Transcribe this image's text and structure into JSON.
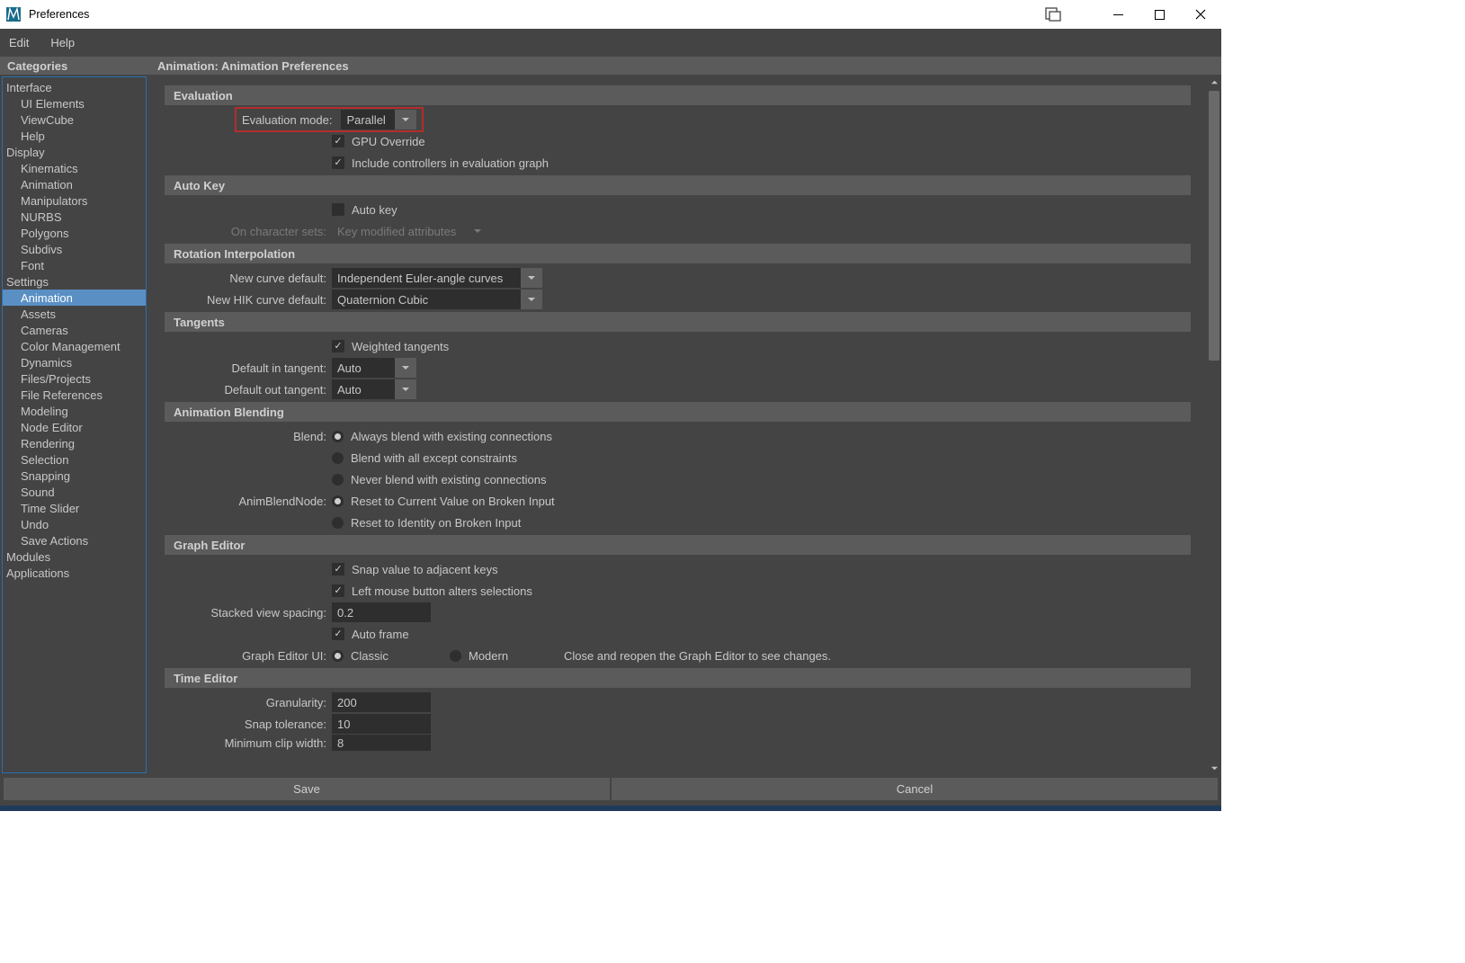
{
  "window": {
    "title": "Preferences"
  },
  "menubar": {
    "edit": "Edit",
    "help": "Help"
  },
  "categories": {
    "header": "Categories",
    "items": [
      {
        "label": "Interface",
        "indent": false
      },
      {
        "label": "UI Elements",
        "indent": true
      },
      {
        "label": "ViewCube",
        "indent": true
      },
      {
        "label": "Help",
        "indent": true
      },
      {
        "label": "Display",
        "indent": false
      },
      {
        "label": "Kinematics",
        "indent": true
      },
      {
        "label": "Animation",
        "indent": true
      },
      {
        "label": "Manipulators",
        "indent": true
      },
      {
        "label": "NURBS",
        "indent": true
      },
      {
        "label": "Polygons",
        "indent": true
      },
      {
        "label": "Subdivs",
        "indent": true
      },
      {
        "label": "Font",
        "indent": true
      },
      {
        "label": "Settings",
        "indent": false
      },
      {
        "label": "Animation",
        "indent": true,
        "selected": true
      },
      {
        "label": "Assets",
        "indent": true
      },
      {
        "label": "Cameras",
        "indent": true
      },
      {
        "label": "Color Management",
        "indent": true
      },
      {
        "label": "Dynamics",
        "indent": true
      },
      {
        "label": "Files/Projects",
        "indent": true
      },
      {
        "label": "File References",
        "indent": true
      },
      {
        "label": "Modeling",
        "indent": true
      },
      {
        "label": "Node Editor",
        "indent": true
      },
      {
        "label": "Rendering",
        "indent": true
      },
      {
        "label": "Selection",
        "indent": true
      },
      {
        "label": "Snapping",
        "indent": true
      },
      {
        "label": "Sound",
        "indent": true
      },
      {
        "label": "Time Slider",
        "indent": true
      },
      {
        "label": "Undo",
        "indent": true
      },
      {
        "label": "Save Actions",
        "indent": true
      },
      {
        "label": "Modules",
        "indent": false
      },
      {
        "label": "Applications",
        "indent": false
      }
    ]
  },
  "main": {
    "title": "Animation: Animation Preferences",
    "evaluation": {
      "header": "Evaluation",
      "mode_label": "Evaluation mode:",
      "mode_value": "Parallel",
      "gpu": "GPU Override",
      "controllers": "Include controllers in evaluation graph"
    },
    "autokey": {
      "header": "Auto Key",
      "auto_label": "Auto key",
      "onchar_label": "On character sets:",
      "onchar_value": "Key modified attributes"
    },
    "rotation": {
      "header": "Rotation Interpolation",
      "newcurve_label": "New curve default:",
      "newcurve_value": "Independent Euler-angle curves",
      "newhik_label": "New HIK curve default:",
      "newhik_value": "Quaternion Cubic"
    },
    "tangents": {
      "header": "Tangents",
      "weighted": "Weighted tangents",
      "in_label": "Default in tangent:",
      "in_value": "Auto",
      "out_label": "Default out tangent:",
      "out_value": "Auto"
    },
    "blending": {
      "header": "Animation Blending",
      "blend_label": "Blend:",
      "opt1": "Always blend with existing connections",
      "opt2": "Blend with all except constraints",
      "opt3": "Never blend with existing connections",
      "abn_label": "AnimBlendNode:",
      "abn1": "Reset to Current Value on Broken Input",
      "abn2": "Reset to Identity on Broken Input"
    },
    "graph": {
      "header": "Graph Editor",
      "snap": "Snap value to adjacent keys",
      "lmb": "Left mouse button alters selections",
      "stack_label": "Stacked view spacing:",
      "stack_value": "0.2",
      "autoframe": "Auto frame",
      "ui_label": "Graph Editor UI:",
      "classic": "Classic",
      "modern": "Modern",
      "note": "Close and reopen the Graph Editor to see changes."
    },
    "timeeditor": {
      "header": "Time Editor",
      "gran_label": "Granularity:",
      "gran_value": "200",
      "snap_label": "Snap tolerance:",
      "snap_value": "10",
      "min_label": "Minimum clip width:",
      "min_value": "8"
    }
  },
  "footer": {
    "save": "Save",
    "cancel": "Cancel"
  }
}
